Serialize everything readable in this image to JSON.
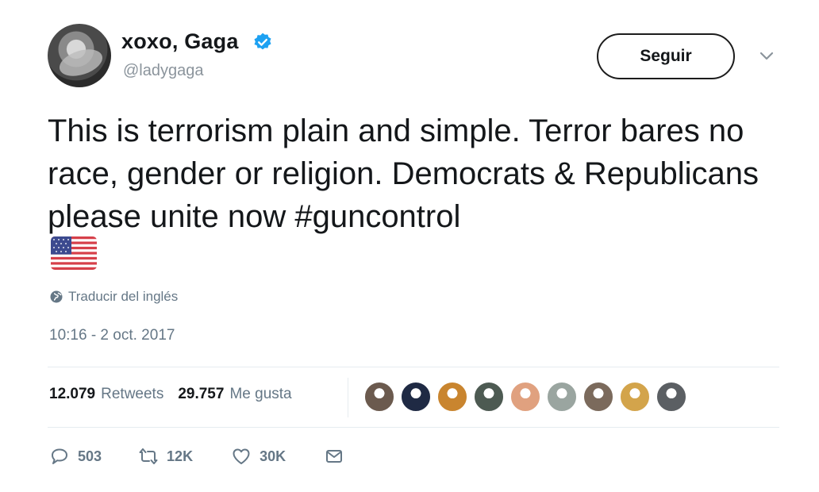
{
  "author": {
    "display_name": "xoxo, Gaga",
    "handle": "@ladygaga",
    "avatar_icon": "profile-photo",
    "verified_icon": "verified-badge-icon",
    "verified_color": "#1da1f2"
  },
  "follow_button": {
    "label": "Seguir"
  },
  "tweet": {
    "text": "This is terrorism plain and simple. Terror bares no race, gender or religion.  Democrats & Republicans please unite now #guncontrol",
    "emoji_icon": "us-flag-icon",
    "translate_label": "Traducir del inglés",
    "timestamp": "10:16 - 2 oct. 2017"
  },
  "stats": {
    "retweets_count": "12.079",
    "retweets_label": "Retweets",
    "likes_count": "29.757",
    "likes_label": "Me gusta"
  },
  "likers": [
    "#6b5a4e",
    "#1f2a44",
    "#c9852f",
    "#4d5a52",
    "#e0a17f",
    "#9aa5a0",
    "#7b6a5c",
    "#d3a44b",
    "#5b5f63"
  ],
  "actions": {
    "reply_count": "503",
    "retweet_count": "12K",
    "like_count": "30K"
  },
  "colors": {
    "text": "#14171a",
    "muted": "#657786",
    "divider": "#e6ecf0"
  }
}
